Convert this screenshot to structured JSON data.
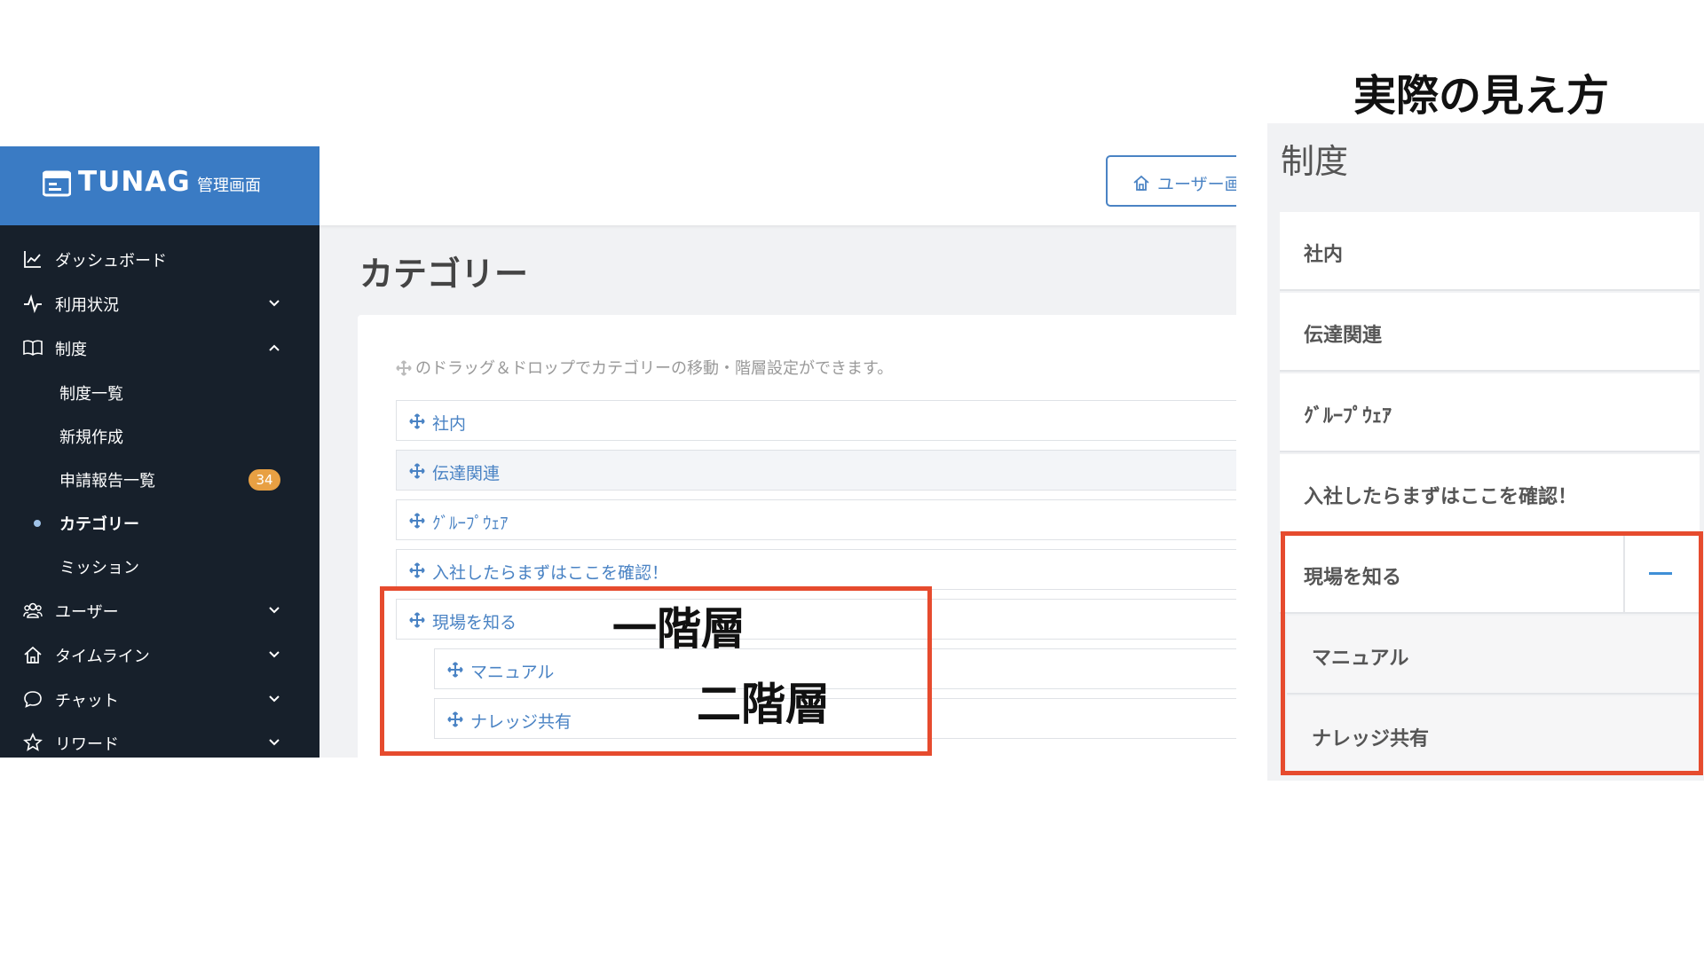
{
  "brand": {
    "name": "TUNAG",
    "subtitle": "管理画面"
  },
  "sidebar": {
    "items": [
      {
        "label": "ダッシュボード",
        "icon": "chart-line-icon",
        "chevron": "none"
      },
      {
        "label": "利用状況",
        "icon": "pulse-icon",
        "chevron": "down"
      },
      {
        "label": "制度",
        "icon": "book-icon",
        "chevron": "up"
      },
      {
        "label": "ユーザー",
        "icon": "users-icon",
        "chevron": "down"
      },
      {
        "label": "タイムライン",
        "icon": "home-icon",
        "chevron": "down"
      },
      {
        "label": "チャット",
        "icon": "chat-bubble-icon",
        "chevron": "down"
      },
      {
        "label": "リワード",
        "icon": "star-icon",
        "chevron": "down"
      }
    ],
    "sub_items": [
      {
        "label": "制度一覧"
      },
      {
        "label": "新規作成"
      },
      {
        "label": "申請報告一覧",
        "badge": "34"
      },
      {
        "label": "カテゴリー",
        "active": true
      },
      {
        "label": "ミッション"
      }
    ]
  },
  "header": {
    "user_button_label": "ユーザー画面"
  },
  "main": {
    "title": "カテゴリー",
    "hint": "のドラッグ＆ドロップでカテゴリーの移動・階層設定ができます。",
    "categories": [
      {
        "label": "社内",
        "level": 1
      },
      {
        "label": "伝達関連",
        "level": 1
      },
      {
        "label": "ｸﾞﾙｰﾌﾟｳｪｱ",
        "level": 1
      },
      {
        "label": "入社したらまずはここを確認！",
        "level": 1
      },
      {
        "label": "現場を知る",
        "level": 1
      },
      {
        "label": "マニュアル",
        "level": 2
      },
      {
        "label": "ナレッジ共有",
        "level": 2
      }
    ]
  },
  "annotations": {
    "level1": "一階層",
    "level2": "二階層"
  },
  "actual_view": {
    "heading": "実際の見え方",
    "section_title": "制度",
    "items": [
      {
        "label": "社内"
      },
      {
        "label": "伝達関連"
      },
      {
        "label": "ｸﾞﾙｰﾌﾟｳｪｱ"
      },
      {
        "label": "入社したらまずはここを確認！"
      },
      {
        "label": "現場を知る",
        "expanded": true
      },
      {
        "label": "マニュアル",
        "child": true
      },
      {
        "label": "ナレッジ共有",
        "child": true
      }
    ]
  },
  "colors": {
    "brand_blue": "#3a7bc4",
    "sidebar_bg": "#17202b",
    "link_blue": "#4a83c4",
    "badge_orange": "#e8a043",
    "annotation_red": "#e64b2e"
  }
}
